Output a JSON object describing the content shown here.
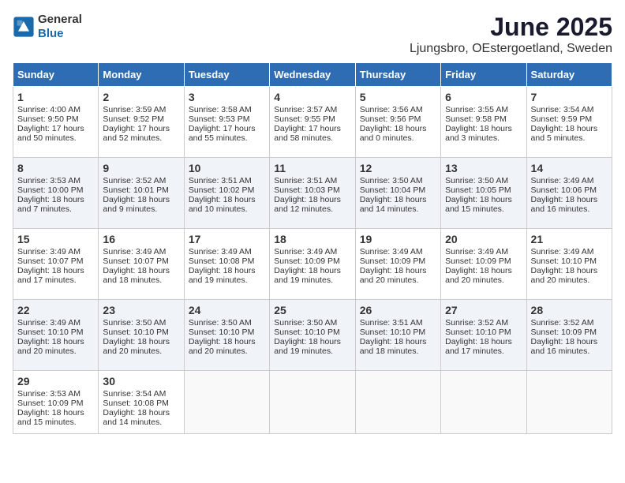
{
  "header": {
    "logo_general": "General",
    "logo_blue": "Blue",
    "title": "June 2025",
    "subtitle": "Ljungsbro, OEstergoetland, Sweden"
  },
  "weekdays": [
    "Sunday",
    "Monday",
    "Tuesday",
    "Wednesday",
    "Thursday",
    "Friday",
    "Saturday"
  ],
  "weeks": [
    [
      {
        "day": "1",
        "sunrise": "Sunrise: 4:00 AM",
        "sunset": "Sunset: 9:50 PM",
        "daylight": "Daylight: 17 hours and 50 minutes."
      },
      {
        "day": "2",
        "sunrise": "Sunrise: 3:59 AM",
        "sunset": "Sunset: 9:52 PM",
        "daylight": "Daylight: 17 hours and 52 minutes."
      },
      {
        "day": "3",
        "sunrise": "Sunrise: 3:58 AM",
        "sunset": "Sunset: 9:53 PM",
        "daylight": "Daylight: 17 hours and 55 minutes."
      },
      {
        "day": "4",
        "sunrise": "Sunrise: 3:57 AM",
        "sunset": "Sunset: 9:55 PM",
        "daylight": "Daylight: 17 hours and 58 minutes."
      },
      {
        "day": "5",
        "sunrise": "Sunrise: 3:56 AM",
        "sunset": "Sunset: 9:56 PM",
        "daylight": "Daylight: 18 hours and 0 minutes."
      },
      {
        "day": "6",
        "sunrise": "Sunrise: 3:55 AM",
        "sunset": "Sunset: 9:58 PM",
        "daylight": "Daylight: 18 hours and 3 minutes."
      },
      {
        "day": "7",
        "sunrise": "Sunrise: 3:54 AM",
        "sunset": "Sunset: 9:59 PM",
        "daylight": "Daylight: 18 hours and 5 minutes."
      }
    ],
    [
      {
        "day": "8",
        "sunrise": "Sunrise: 3:53 AM",
        "sunset": "Sunset: 10:00 PM",
        "daylight": "Daylight: 18 hours and 7 minutes."
      },
      {
        "day": "9",
        "sunrise": "Sunrise: 3:52 AM",
        "sunset": "Sunset: 10:01 PM",
        "daylight": "Daylight: 18 hours and 9 minutes."
      },
      {
        "day": "10",
        "sunrise": "Sunrise: 3:51 AM",
        "sunset": "Sunset: 10:02 PM",
        "daylight": "Daylight: 18 hours and 10 minutes."
      },
      {
        "day": "11",
        "sunrise": "Sunrise: 3:51 AM",
        "sunset": "Sunset: 10:03 PM",
        "daylight": "Daylight: 18 hours and 12 minutes."
      },
      {
        "day": "12",
        "sunrise": "Sunrise: 3:50 AM",
        "sunset": "Sunset: 10:04 PM",
        "daylight": "Daylight: 18 hours and 14 minutes."
      },
      {
        "day": "13",
        "sunrise": "Sunrise: 3:50 AM",
        "sunset": "Sunset: 10:05 PM",
        "daylight": "Daylight: 18 hours and 15 minutes."
      },
      {
        "day": "14",
        "sunrise": "Sunrise: 3:49 AM",
        "sunset": "Sunset: 10:06 PM",
        "daylight": "Daylight: 18 hours and 16 minutes."
      }
    ],
    [
      {
        "day": "15",
        "sunrise": "Sunrise: 3:49 AM",
        "sunset": "Sunset: 10:07 PM",
        "daylight": "Daylight: 18 hours and 17 minutes."
      },
      {
        "day": "16",
        "sunrise": "Sunrise: 3:49 AM",
        "sunset": "Sunset: 10:07 PM",
        "daylight": "Daylight: 18 hours and 18 minutes."
      },
      {
        "day": "17",
        "sunrise": "Sunrise: 3:49 AM",
        "sunset": "Sunset: 10:08 PM",
        "daylight": "Daylight: 18 hours and 19 minutes."
      },
      {
        "day": "18",
        "sunrise": "Sunrise: 3:49 AM",
        "sunset": "Sunset: 10:09 PM",
        "daylight": "Daylight: 18 hours and 19 minutes."
      },
      {
        "day": "19",
        "sunrise": "Sunrise: 3:49 AM",
        "sunset": "Sunset: 10:09 PM",
        "daylight": "Daylight: 18 hours and 20 minutes."
      },
      {
        "day": "20",
        "sunrise": "Sunrise: 3:49 AM",
        "sunset": "Sunset: 10:09 PM",
        "daylight": "Daylight: 18 hours and 20 minutes."
      },
      {
        "day": "21",
        "sunrise": "Sunrise: 3:49 AM",
        "sunset": "Sunset: 10:10 PM",
        "daylight": "Daylight: 18 hours and 20 minutes."
      }
    ],
    [
      {
        "day": "22",
        "sunrise": "Sunrise: 3:49 AM",
        "sunset": "Sunset: 10:10 PM",
        "daylight": "Daylight: 18 hours and 20 minutes."
      },
      {
        "day": "23",
        "sunrise": "Sunrise: 3:50 AM",
        "sunset": "Sunset: 10:10 PM",
        "daylight": "Daylight: 18 hours and 20 minutes."
      },
      {
        "day": "24",
        "sunrise": "Sunrise: 3:50 AM",
        "sunset": "Sunset: 10:10 PM",
        "daylight": "Daylight: 18 hours and 20 minutes."
      },
      {
        "day": "25",
        "sunrise": "Sunrise: 3:50 AM",
        "sunset": "Sunset: 10:10 PM",
        "daylight": "Daylight: 18 hours and 19 minutes."
      },
      {
        "day": "26",
        "sunrise": "Sunrise: 3:51 AM",
        "sunset": "Sunset: 10:10 PM",
        "daylight": "Daylight: 18 hours and 18 minutes."
      },
      {
        "day": "27",
        "sunrise": "Sunrise: 3:52 AM",
        "sunset": "Sunset: 10:10 PM",
        "daylight": "Daylight: 18 hours and 17 minutes."
      },
      {
        "day": "28",
        "sunrise": "Sunrise: 3:52 AM",
        "sunset": "Sunset: 10:09 PM",
        "daylight": "Daylight: 18 hours and 16 minutes."
      }
    ],
    [
      {
        "day": "29",
        "sunrise": "Sunrise: 3:53 AM",
        "sunset": "Sunset: 10:09 PM",
        "daylight": "Daylight: 18 hours and 15 minutes."
      },
      {
        "day": "30",
        "sunrise": "Sunrise: 3:54 AM",
        "sunset": "Sunset: 10:08 PM",
        "daylight": "Daylight: 18 hours and 14 minutes."
      },
      null,
      null,
      null,
      null,
      null
    ]
  ]
}
